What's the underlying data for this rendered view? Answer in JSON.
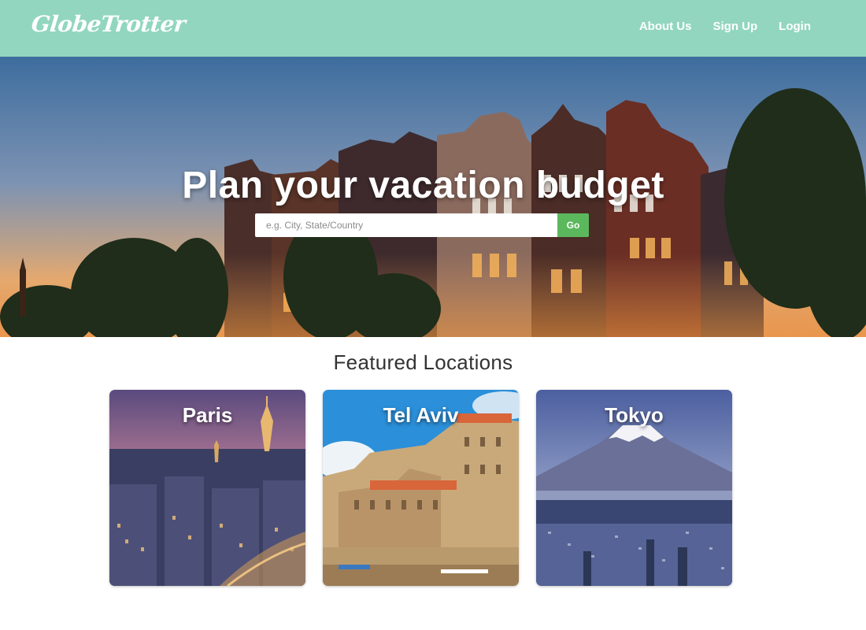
{
  "brand": {
    "logo_text": "GlobeTrotter"
  },
  "nav": {
    "links": [
      {
        "label": "About Us"
      },
      {
        "label": "Sign Up"
      },
      {
        "label": "Login"
      }
    ]
  },
  "hero": {
    "title": "Plan your vacation budget",
    "search_placeholder": "e.g. City, State/Country",
    "go_label": "Go"
  },
  "featured": {
    "title": "Featured Locations",
    "cards": [
      {
        "label": "Paris"
      },
      {
        "label": "Tel Aviv"
      },
      {
        "label": "Tokyo"
      }
    ]
  },
  "colors": {
    "navbar": "#92d6bf",
    "go_button": "#5cb85c",
    "text_dark": "#333333"
  }
}
